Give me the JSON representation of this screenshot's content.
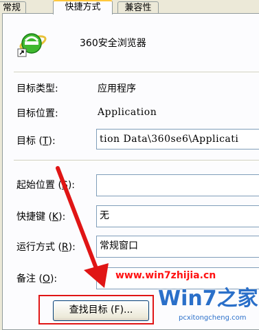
{
  "tabs": [
    {
      "label": "常规"
    },
    {
      "label": "快捷方式"
    },
    {
      "label": "兼容性"
    }
  ],
  "app": {
    "name": "360安全浏览器",
    "icon": "ie-browser-icon"
  },
  "rows": {
    "target_type": {
      "label": "目标类型:",
      "value": "应用程序"
    },
    "target_location": {
      "label": "目标位置:",
      "value": "Application"
    },
    "target": {
      "label_prefix": "目标 (",
      "label_key": "T",
      "label_suffix": "):",
      "value": "tion Data\\360se6\\Applicati"
    },
    "start_in": {
      "label_prefix": "起始位置 (",
      "label_key": "S",
      "label_suffix": "):",
      "value": ""
    },
    "shortcut_key": {
      "label_prefix": "快捷键 (",
      "label_key": "K",
      "label_suffix": "):",
      "value": "无"
    },
    "run": {
      "label_prefix": "运行方式 (",
      "label_key": "R",
      "label_suffix": "):",
      "value": "常规窗口"
    },
    "comment": {
      "label_prefix": "备注 (",
      "label_key": "O",
      "label_suffix": "):",
      "value": ""
    }
  },
  "buttons": {
    "find_target": "查找目标 (F)..."
  },
  "watermark": {
    "url": "www.win7zhijia.cn",
    "logo": "Win7之家",
    "domain": "pcxitongcheng.com"
  },
  "colors": {
    "arrow": "#e01515",
    "focus": "#2a6fc9"
  }
}
